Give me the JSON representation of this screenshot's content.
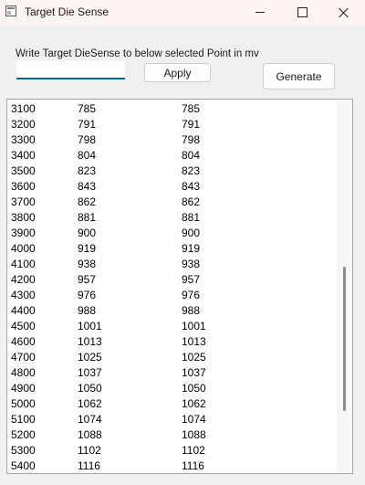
{
  "window": {
    "title": "Target Die Sense"
  },
  "form": {
    "instruction": "Write Target DieSense to below selected Point in mv",
    "input_value": "",
    "apply_label": "Apply",
    "generate_label": "Generate"
  },
  "rows": [
    [
      "3100",
      "785",
      "785"
    ],
    [
      "3200",
      "791",
      "791"
    ],
    [
      "3300",
      "798",
      "798"
    ],
    [
      "3400",
      "804",
      "804"
    ],
    [
      "3500",
      "823",
      "823"
    ],
    [
      "3600",
      "843",
      "843"
    ],
    [
      "3700",
      "862",
      "862"
    ],
    [
      "3800",
      "881",
      "881"
    ],
    [
      "3900",
      "900",
      "900"
    ],
    [
      "4000",
      "919",
      "919"
    ],
    [
      "4100",
      "938",
      "938"
    ],
    [
      "4200",
      "957",
      "957"
    ],
    [
      "4300",
      "976",
      "976"
    ],
    [
      "4400",
      "988",
      "988"
    ],
    [
      "4500",
      "1001",
      "1001"
    ],
    [
      "4600",
      "1013",
      "1013"
    ],
    [
      "4700",
      "1025",
      "1025"
    ],
    [
      "4800",
      "1037",
      "1037"
    ],
    [
      "4900",
      "1050",
      "1050"
    ],
    [
      "5000",
      "1062",
      "1062"
    ],
    [
      "5100",
      "1074",
      "1074"
    ],
    [
      "5200",
      "1088",
      "1088"
    ],
    [
      "5300",
      "1102",
      "1102"
    ],
    [
      "5400",
      "1116",
      "1116"
    ]
  ]
}
